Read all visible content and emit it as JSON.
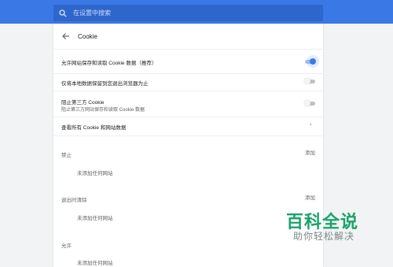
{
  "search": {
    "placeholder": "在设置中搜索",
    "icon": "search-icon"
  },
  "header": {
    "title": "Cookie",
    "back_icon": "back-arrow-icon"
  },
  "settings": [
    {
      "label": "允许网站保存和读取 Cookie 数据（推荐）",
      "enabled": true
    },
    {
      "label": "仅将本地数据保留到您退出浏览器为止",
      "enabled": false
    },
    {
      "label": "阻止第三方 Cookie",
      "sublabel": "阻止第三方网站保存和读取 Cookie 数据",
      "enabled": false
    }
  ],
  "see_all": {
    "label": "查看所有 Cookie 和网站数据",
    "icon": "chevron-right-icon"
  },
  "sections": [
    {
      "title": "禁止",
      "add_label": "添加",
      "empty_text": "未添加任何网站"
    },
    {
      "title": "退出时清除",
      "add_label": "添加",
      "empty_text": "未添加任何网站"
    },
    {
      "title": "允许",
      "add_label": "",
      "empty_text": "未添加任何网站"
    }
  ],
  "watermark": {
    "big": "百科全说",
    "small": "助你轻松解决"
  },
  "colors": {
    "topbar": "#3a78e6",
    "accent": "#3b7be8",
    "watermark": "#1aa36a"
  }
}
